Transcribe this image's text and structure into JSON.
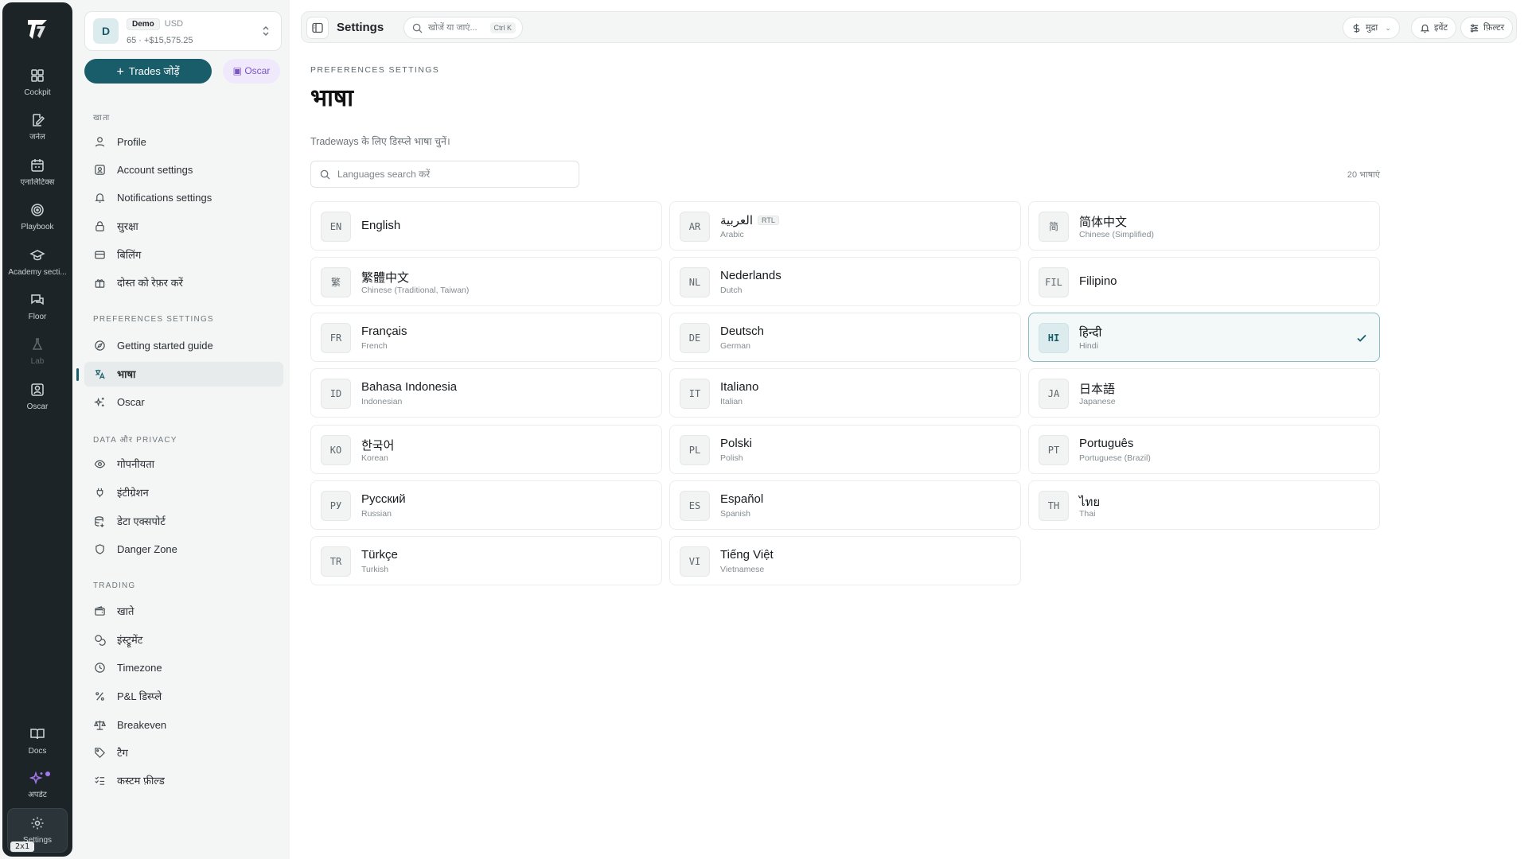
{
  "rail": {
    "items": [
      {
        "label": "Cockpit",
        "icon": "grid-icon"
      },
      {
        "label": "जर्नल",
        "icon": "journal-icon"
      },
      {
        "label": "एनालिटिक्स",
        "icon": "calendar-icon"
      },
      {
        "label": "Playbook",
        "icon": "target-icon"
      },
      {
        "label": "Academy secti...",
        "icon": "graduation-cap-icon"
      },
      {
        "label": "Floor",
        "icon": "chat-icon"
      },
      {
        "label": "Lab",
        "icon": "flask-icon"
      },
      {
        "label": "Oscar",
        "icon": "oscar-icon"
      },
      {
        "label": "Docs",
        "icon": "book-icon"
      },
      {
        "label": "अपडेट",
        "icon": "sparkle-icon"
      },
      {
        "label": "Settings",
        "icon": "gear-icon"
      }
    ],
    "tag": "2x1"
  },
  "account": {
    "initial": "D",
    "name": "Demo",
    "currency": "USD",
    "balance": "65 · +$15,575.25"
  },
  "actions": {
    "add_trades": "Trades जोड़ें",
    "oscar": "Oscar"
  },
  "sidebar": {
    "sections": [
      {
        "label": "खाता",
        "items": [
          "Profile",
          "Account settings",
          "Notifications settings",
          "सुरक्षा",
          "बिलिंग",
          "दोस्त को रेफ़र करें"
        ]
      },
      {
        "label": "Preferences settings",
        "items": [
          "Getting started guide",
          "भाषा",
          "Oscar"
        ]
      },
      {
        "label": "Data और Privacy",
        "items": [
          "गोपनीयता",
          "इंटीग्रेशन",
          "डेटा एक्सपोर्ट",
          "Danger Zone"
        ]
      },
      {
        "label": "Trading",
        "items": [
          "खाते",
          "इंस्ट्रूमेंट",
          "Timezone",
          "P&L डिस्प्ले",
          "Breakeven",
          "टैग",
          "कस्टम फ़ील्ड"
        ]
      }
    ]
  },
  "topbar": {
    "title": "Settings",
    "search_placeholder": "खोजें या जाएं...",
    "search_shortcut": "Ctrl K",
    "currency": "मुद्रा",
    "events": "इवेंट",
    "filter": "फ़िल्टर"
  },
  "page": {
    "eyebrow": "Preferences settings",
    "title": "भाषा",
    "description": "Tradeways के लिए डिस्प्ले भाषा चुनें।",
    "search_placeholder": "Languages search करें",
    "count": "20 भाषाएं"
  },
  "languages": [
    {
      "code": "EN",
      "name": "English",
      "sub": ""
    },
    {
      "code": "AR",
      "name": "العربية",
      "sub": "Arabic",
      "badge": "RTL"
    },
    {
      "code": "简",
      "name": "简体中文",
      "sub": "Chinese (Simplified)"
    },
    {
      "code": "繁",
      "name": "繁體中文",
      "sub": "Chinese (Traditional, Taiwan)"
    },
    {
      "code": "NL",
      "name": "Nederlands",
      "sub": "Dutch"
    },
    {
      "code": "FIL",
      "name": "Filipino",
      "sub": ""
    },
    {
      "code": "FR",
      "name": "Français",
      "sub": "French"
    },
    {
      "code": "DE",
      "name": "Deutsch",
      "sub": "German"
    },
    {
      "code": "HI",
      "name": "हिन्दी",
      "sub": "Hindi",
      "selected": true
    },
    {
      "code": "ID",
      "name": "Bahasa Indonesia",
      "sub": "Indonesian"
    },
    {
      "code": "IT",
      "name": "Italiano",
      "sub": "Italian"
    },
    {
      "code": "JA",
      "name": "日本語",
      "sub": "Japanese"
    },
    {
      "code": "KO",
      "name": "한국어",
      "sub": "Korean"
    },
    {
      "code": "PL",
      "name": "Polski",
      "sub": "Polish"
    },
    {
      "code": "PT",
      "name": "Português",
      "sub": "Portuguese (Brazil)"
    },
    {
      "code": "РУ",
      "name": "Русский",
      "sub": "Russian"
    },
    {
      "code": "ES",
      "name": "Español",
      "sub": "Spanish"
    },
    {
      "code": "TH",
      "name": "ไทย",
      "sub": "Thai"
    },
    {
      "code": "TR",
      "name": "Türkçe",
      "sub": "Turkish"
    },
    {
      "code": "VI",
      "name": "Tiếng Việt",
      "sub": "Vietnamese"
    }
  ],
  "colors": {
    "accent": "#195d6a",
    "rail": "#1d2427",
    "oscar": "#7b52c9",
    "selected_border": "#8dbcc4"
  }
}
